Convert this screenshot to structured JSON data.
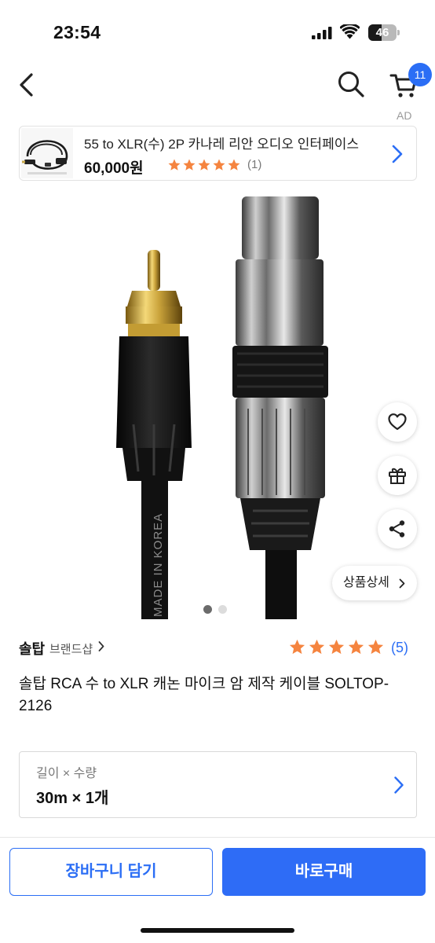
{
  "status_bar": {
    "time": "23:54",
    "battery_level": "46",
    "battery_fraction": 0.46
  },
  "header": {
    "back_icon": "chevron-left-icon",
    "search_icon": "search-icon",
    "cart_icon": "cart-icon",
    "cart_badge": "11",
    "accent_color": "#2b6ef5"
  },
  "ad": {
    "label": "AD",
    "title": "55 to XLR(수) 2P 카나레 리안 오디오 인터페이스",
    "price": "60,000원",
    "rating_stars": 5,
    "review_count": "(1)"
  },
  "gallery": {
    "current_index": 1,
    "total": 2,
    "cable_print": "MADE IN KOREA"
  },
  "floating_actions": {
    "wishlist_icon": "heart-icon",
    "gift_icon": "gift-icon",
    "share_icon": "share-icon",
    "detail_label": "상품상세"
  },
  "product": {
    "brand": "솔탑",
    "brand_shop": "브랜드샵",
    "rating_stars": 5,
    "review_count": "(5)",
    "star_color": "#f5843f",
    "title": "솔탑 RCA 수 to XLR 캐논 마이크 암 제작 케이블 SOLTOP-2126"
  },
  "option": {
    "label": "길이 × 수량",
    "value": "30m × 1개"
  },
  "actions": {
    "add_to_cart": "장바구니 담기",
    "buy_now": "바로구매"
  }
}
